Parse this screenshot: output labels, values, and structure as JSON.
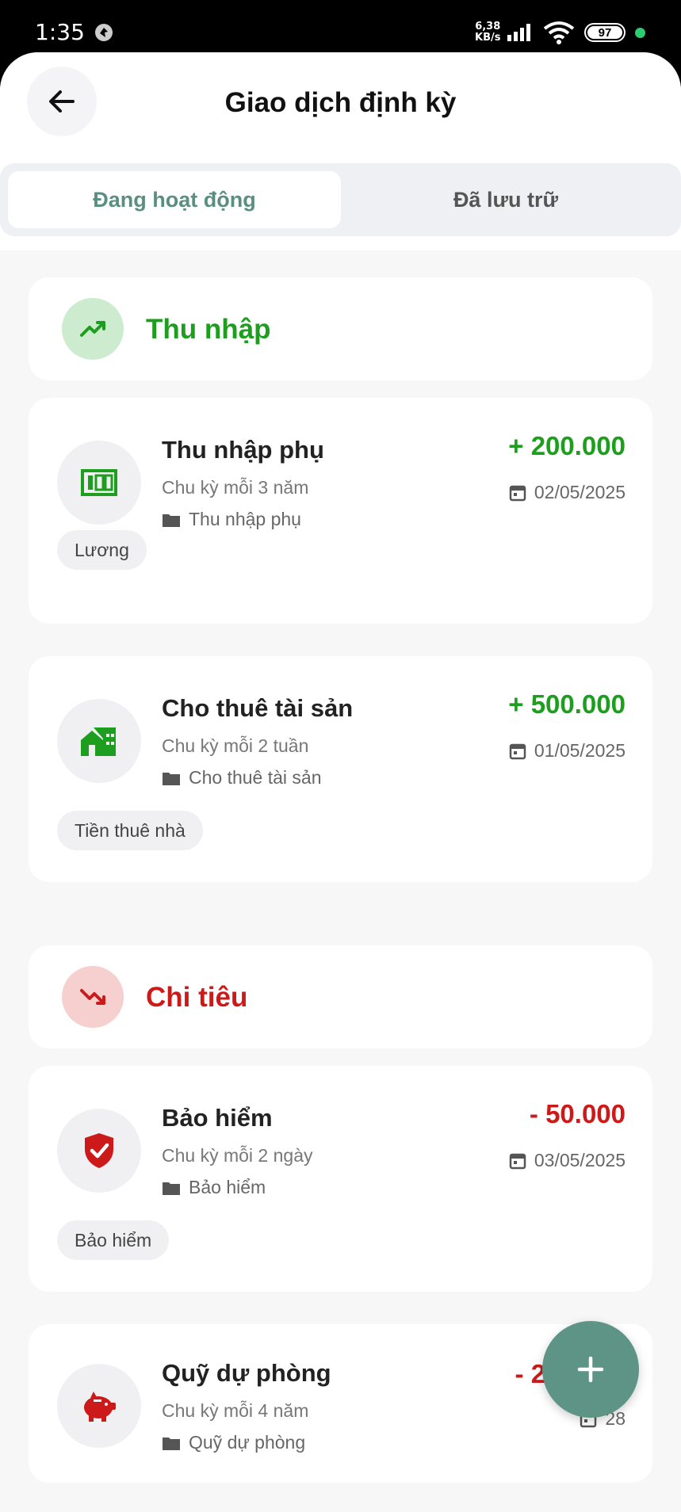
{
  "status_bar": {
    "time": "1:35",
    "speed_top": "6,38",
    "speed_bottom": "KB/s",
    "battery": "97"
  },
  "header": {
    "title": "Giao dịch định kỳ",
    "back_icon": "arrow-left-icon"
  },
  "tabs": [
    {
      "label": "Đang hoạt động",
      "active": true
    },
    {
      "label": "Đã lưu trữ",
      "active": false
    }
  ],
  "sections": {
    "income": {
      "title": "Thu nhập",
      "color": "#1e9e1e",
      "icon_bg": "#cdeccf",
      "icon": "trending-up-icon",
      "cards": [
        {
          "title": "Thu nhập phụ",
          "cycle": "Chu kỳ mỗi 3 năm",
          "category": "Thu nhập phụ",
          "amount": "+ 200.000",
          "date": "02/05/2025",
          "tag": "Lương",
          "icon": "cash-icon"
        },
        {
          "title": "Cho thuê tài sản",
          "cycle": "Chu kỳ mỗi 2 tuần",
          "category": "Cho thuê tài sản",
          "amount": "+ 500.000",
          "date": "01/05/2025",
          "tag": "Tiền thuê nhà",
          "icon": "house-rent-icon"
        }
      ]
    },
    "expense": {
      "title": "Chi tiêu",
      "color": "#cc1a1a",
      "icon_bg": "#f6cfcf",
      "icon": "trending-down-icon",
      "cards": [
        {
          "title": "Bảo hiểm",
          "cycle": "Chu kỳ mỗi 2 ngày",
          "category": "Bảo hiểm",
          "amount": "- 50.000",
          "date": "03/05/2025",
          "tag": "Bảo hiểm",
          "icon": "shield-check-icon"
        },
        {
          "title": "Quỹ dự phòng",
          "cycle": "Chu kỳ mỗi 4 năm",
          "category": "Quỹ dự phòng",
          "amount": "- 200.000",
          "date": "28",
          "icon": "piggy-bank-icon"
        }
      ]
    }
  },
  "fab": {
    "icon": "plus-icon",
    "color": "#5d9485"
  }
}
